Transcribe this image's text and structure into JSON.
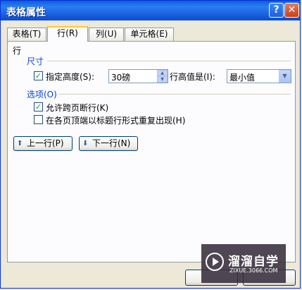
{
  "window": {
    "title": "表格属性"
  },
  "tabs": [
    {
      "label": "表格(T)"
    },
    {
      "label": "行(R)"
    },
    {
      "label": "列(U)"
    },
    {
      "label": "单元格(E)"
    }
  ],
  "row_panel": {
    "heading": "行",
    "size_group": {
      "title": "尺寸",
      "specify_height_label": "指定高度(S):",
      "specify_height_checked": true,
      "height_value": "30磅",
      "height_rule_label": "行高值是(I):",
      "height_rule_value": "最小值"
    },
    "options_group": {
      "title": "选项(O)",
      "allow_break_label": "允许跨页断行(K)",
      "allow_break_checked": true,
      "repeat_header_label": "在各页顶端以标题行形式重复出现(H)",
      "repeat_header_checked": false
    },
    "prev_row_label": "上一行(P)",
    "next_row_label": "下一行(N)"
  },
  "watermark": {
    "name": "溜溜自学",
    "url": "ZIXUE.3066.COM"
  }
}
